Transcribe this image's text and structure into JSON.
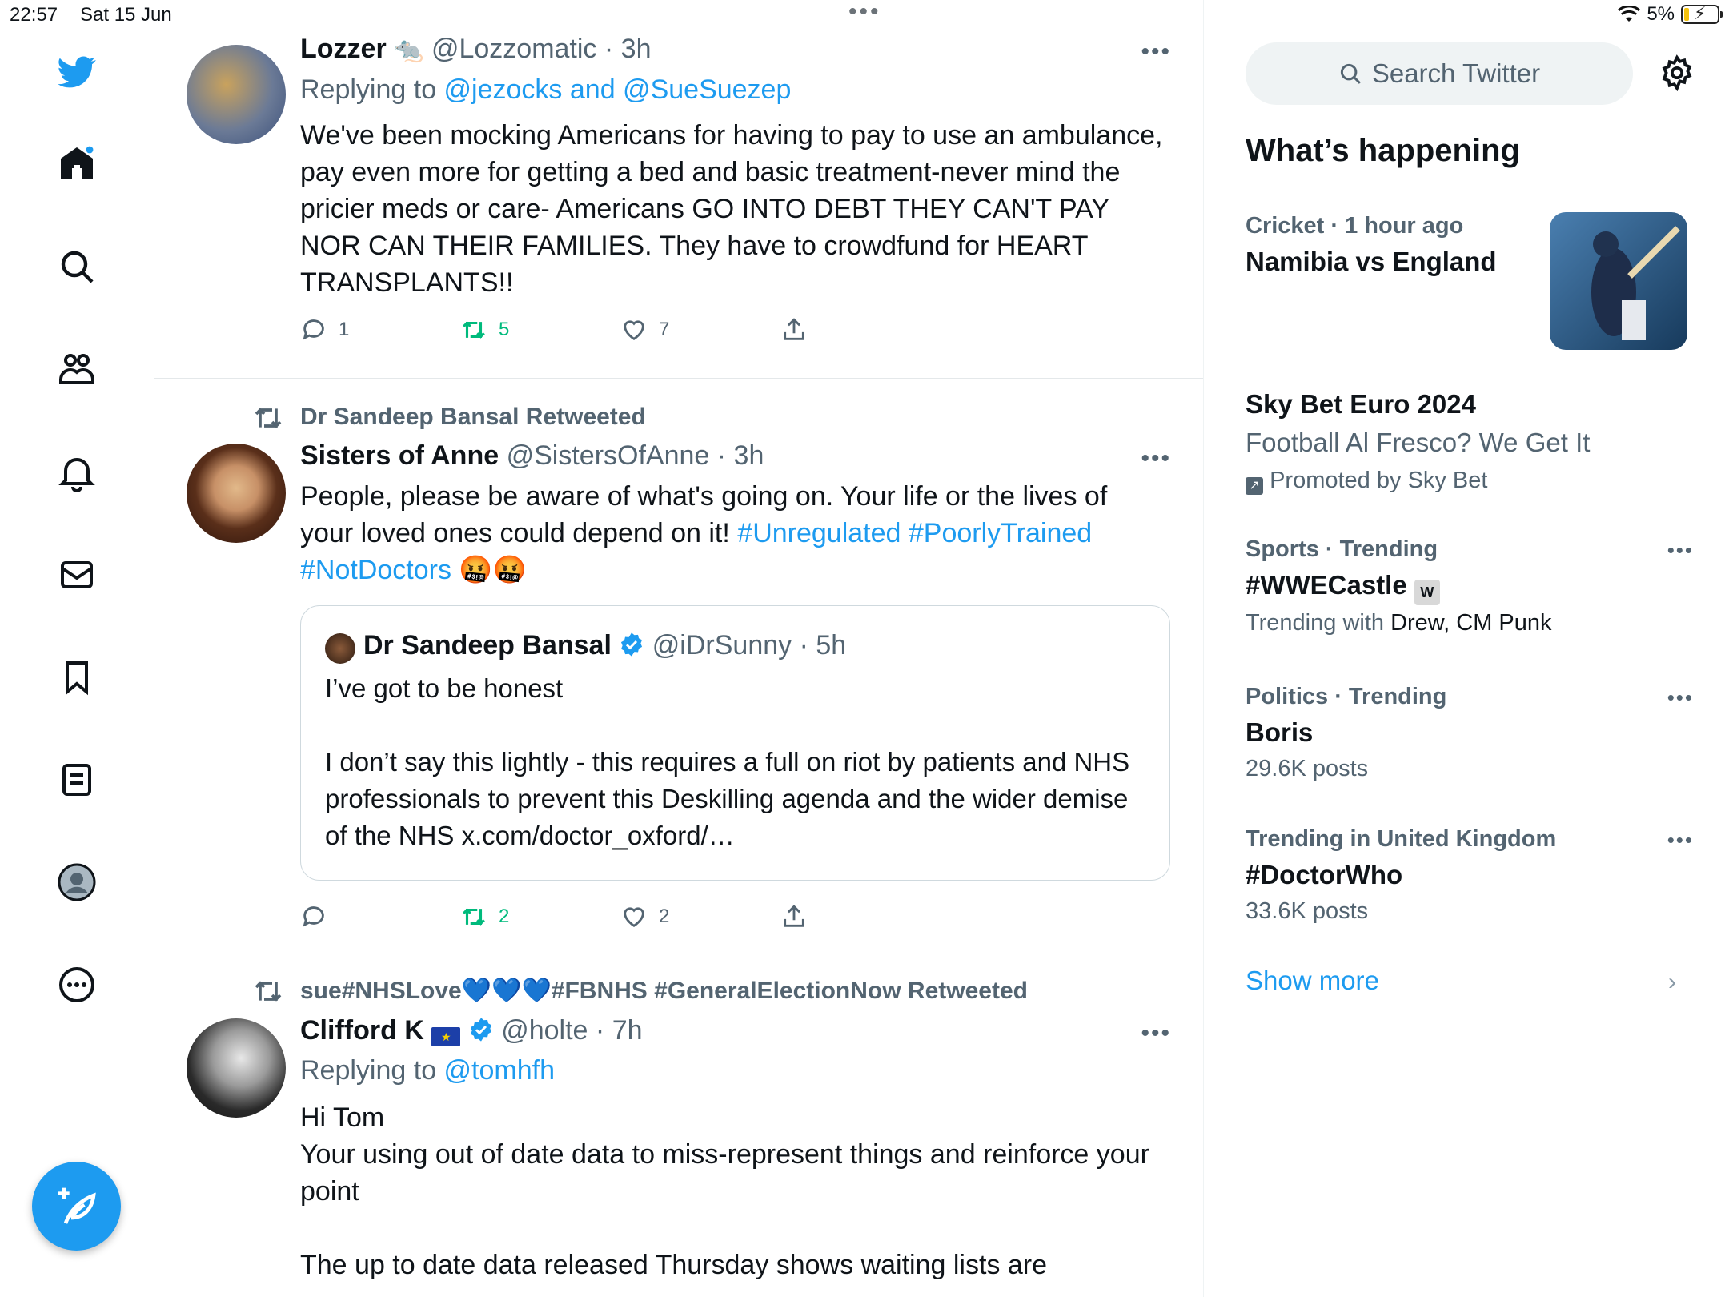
{
  "status_bar": {
    "time": "22:57",
    "date": "Sat 15 Jun",
    "battery": "5%"
  },
  "nav": {
    "items": [
      "twitter-logo",
      "home",
      "explore",
      "communities",
      "notifications",
      "messages",
      "bookmarks",
      "lists",
      "profile",
      "more"
    ],
    "compose_label": "Compose"
  },
  "tweets": [
    {
      "name": "Lozzer",
      "handle": "@Lozzomatic",
      "time": "· 3h",
      "replying_prefix": "Replying to ",
      "replying_to": "@jezocks and @SueSuezep",
      "text": "We've been mocking Americans for having to pay to use an ambulance, pay even more for getting a bed and basic treatment-never mind the pricier meds or care- Americans GO INTO DEBT THEY CAN'T PAY NOR CAN THEIR FAMILIES. They have to crowdfund for HEART TRANSPLANTS!!",
      "replies": "1",
      "retweets": "5",
      "likes": "7"
    },
    {
      "retweeted_by": "Dr Sandeep Bansal Retweeted",
      "name": "Sisters of Anne",
      "handle": "@SistersOfAnne",
      "time": "· 3h",
      "text_plain": "People, please be aware of what's going on. Your life or the lives of your loved ones could depend on it! ",
      "hashtags": [
        "#Unregulated",
        "#PoorlyTrained",
        "#NotDoctors"
      ],
      "quote": {
        "name": "Dr Sandeep Bansal",
        "handle": "@iDrSunny",
        "time": "· 5h",
        "line1": "I’ve got to be honest",
        "line2": "I don’t say this lightly - this requires a full on riot by patients and NHS professionals to prevent this Deskilling agenda and the wider demise of the NHS x.com/doctor_oxford/…"
      },
      "replies": "",
      "retweets": "2",
      "likes": "2"
    },
    {
      "retweeted_by": "sue#NHSLove💙💙💙#FBNHS #GeneralElectionNow Retweeted",
      "name": "Clifford K",
      "handle": "@holte",
      "time": "· 7h",
      "replying_prefix": "Replying to ",
      "replying_to": "@tomhfh",
      "line1": "Hi Tom",
      "line2": "Your using out of date data to miss-represent things and reinforce your point",
      "line3": "The up to date data released Thursday shows waiting lists are"
    }
  ],
  "right": {
    "search_placeholder": "Search Twitter",
    "heading": "What’s happening",
    "trends": [
      {
        "meta": "Cricket · 1 hour ago",
        "title": "Namibia vs England"
      },
      {
        "title": "Sky Bet Euro 2024",
        "sub": "Football Al Fresco? We Get It",
        "promo": "Promoted by Sky Bet"
      },
      {
        "meta": "Sports · Trending",
        "title": "#WWECastle",
        "sub_prefix": "Trending with ",
        "sub_names": "Drew, CM Punk"
      },
      {
        "meta": "Politics · Trending",
        "title": "Boris",
        "sub": "29.6K posts"
      },
      {
        "meta": "Trending in United Kingdom",
        "title": "#DoctorWho",
        "sub": "33.6K posts"
      }
    ],
    "show_more": "Show more"
  },
  "colors": {
    "accent": "#1d9bf0",
    "retweet": "#00ba7c",
    "muted": "#536471"
  }
}
